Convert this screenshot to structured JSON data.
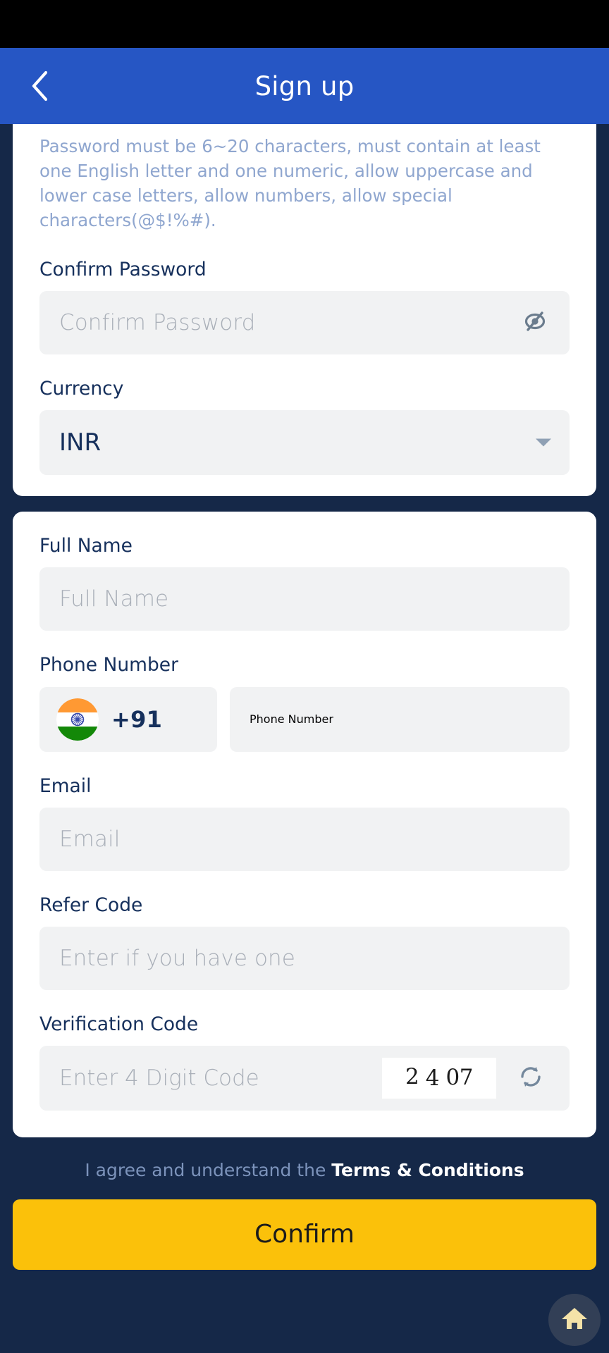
{
  "header": {
    "title": "Sign up",
    "back_icon": "chevron-left-icon"
  },
  "password_rules": {
    "hint": "Password must be 6~20 characters, must contain at least one English letter and one numeric, allow uppercase and lower case letters, allow numbers, allow special characters(@$!%#)."
  },
  "form": {
    "confirm_password": {
      "label": "Confirm Password",
      "placeholder": "Confirm Password",
      "value": "",
      "toggle_icon": "eye-slash-icon"
    },
    "currency": {
      "label": "Currency",
      "selected": "INR",
      "caret_icon": "chevron-down-icon"
    },
    "full_name": {
      "label": "Full Name",
      "placeholder": "Full Name",
      "value": ""
    },
    "phone": {
      "label": "Phone Number",
      "country_flag": "india-flag-icon",
      "country_code": "+91",
      "placeholder": "Phone Number",
      "value": ""
    },
    "email": {
      "label": "Email",
      "placeholder": "Email",
      "value": ""
    },
    "refer_code": {
      "label": "Refer Code",
      "placeholder": "Enter if you have one",
      "value": ""
    },
    "verification_code": {
      "label": "Verification Code",
      "placeholder": "Enter 4 Digit Code",
      "value": "",
      "captcha_digits": [
        "2",
        "4",
        "07"
      ],
      "captcha_text": "2 4 07",
      "refresh_icon": "refresh-icon"
    }
  },
  "footer": {
    "agree_text": "I agree and understand the ",
    "terms_link": "Terms & Conditions",
    "confirm_label": "Confirm",
    "home_icon": "home-icon"
  },
  "colors": {
    "page_background": "#152848",
    "header_blue": "#2656c4",
    "card_white": "#ffffff",
    "input_gray": "#f1f2f3",
    "label_navy": "#16305c",
    "placeholder_gray": "#a9afb8",
    "hint_blue": "#8fa6cf",
    "accent_yellow": "#fbc10a",
    "flag_saffron": "#ff9933",
    "flag_green": "#138808",
    "flag_chakra": "#3b4cad"
  }
}
